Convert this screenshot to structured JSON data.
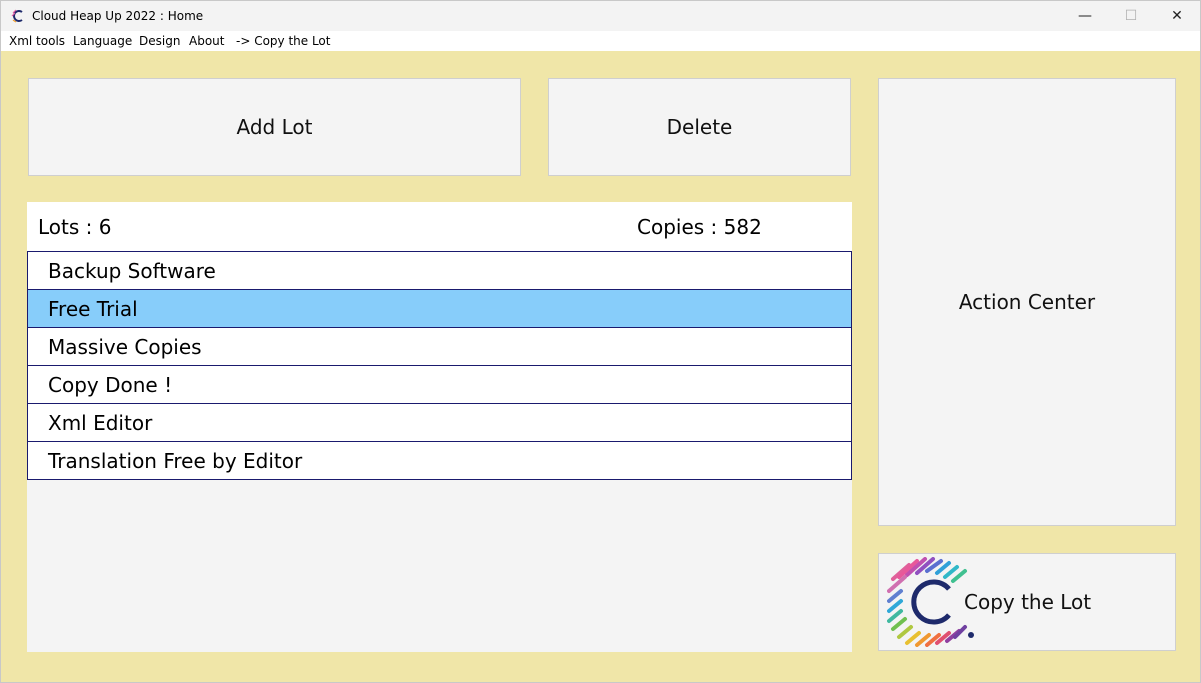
{
  "window": {
    "title": "Cloud Heap Up 2022 : Home",
    "controls": {
      "minimize": "—",
      "maximize": "☐",
      "close": "✕"
    }
  },
  "menu": {
    "items": [
      "Xml tools",
      "Language",
      "Design",
      "About",
      "-> Copy the Lot"
    ]
  },
  "buttons": {
    "add_lot": "Add Lot",
    "delete": "Delete",
    "action_center": "Action Center",
    "copy_the_lot": "Copy the Lot"
  },
  "list": {
    "lots_label": "Lots : 6",
    "copies_label": "Copies : 582",
    "items": [
      {
        "label": "Backup Software",
        "selected": false
      },
      {
        "label": "Free Trial",
        "selected": true
      },
      {
        "label": "Massive Copies",
        "selected": false
      },
      {
        "label": "Copy Done !",
        "selected": false
      },
      {
        "label": "Xml Editor",
        "selected": false
      },
      {
        "label": "Translation Free by Editor",
        "selected": false
      }
    ]
  },
  "colors": {
    "background": "#f0e6a8",
    "selected_row": "#87cdfa",
    "row_border": "#1a1a6e"
  },
  "icons": {
    "app": "app-logo-icon",
    "copy_button": "rainbow-c-logo-icon"
  }
}
